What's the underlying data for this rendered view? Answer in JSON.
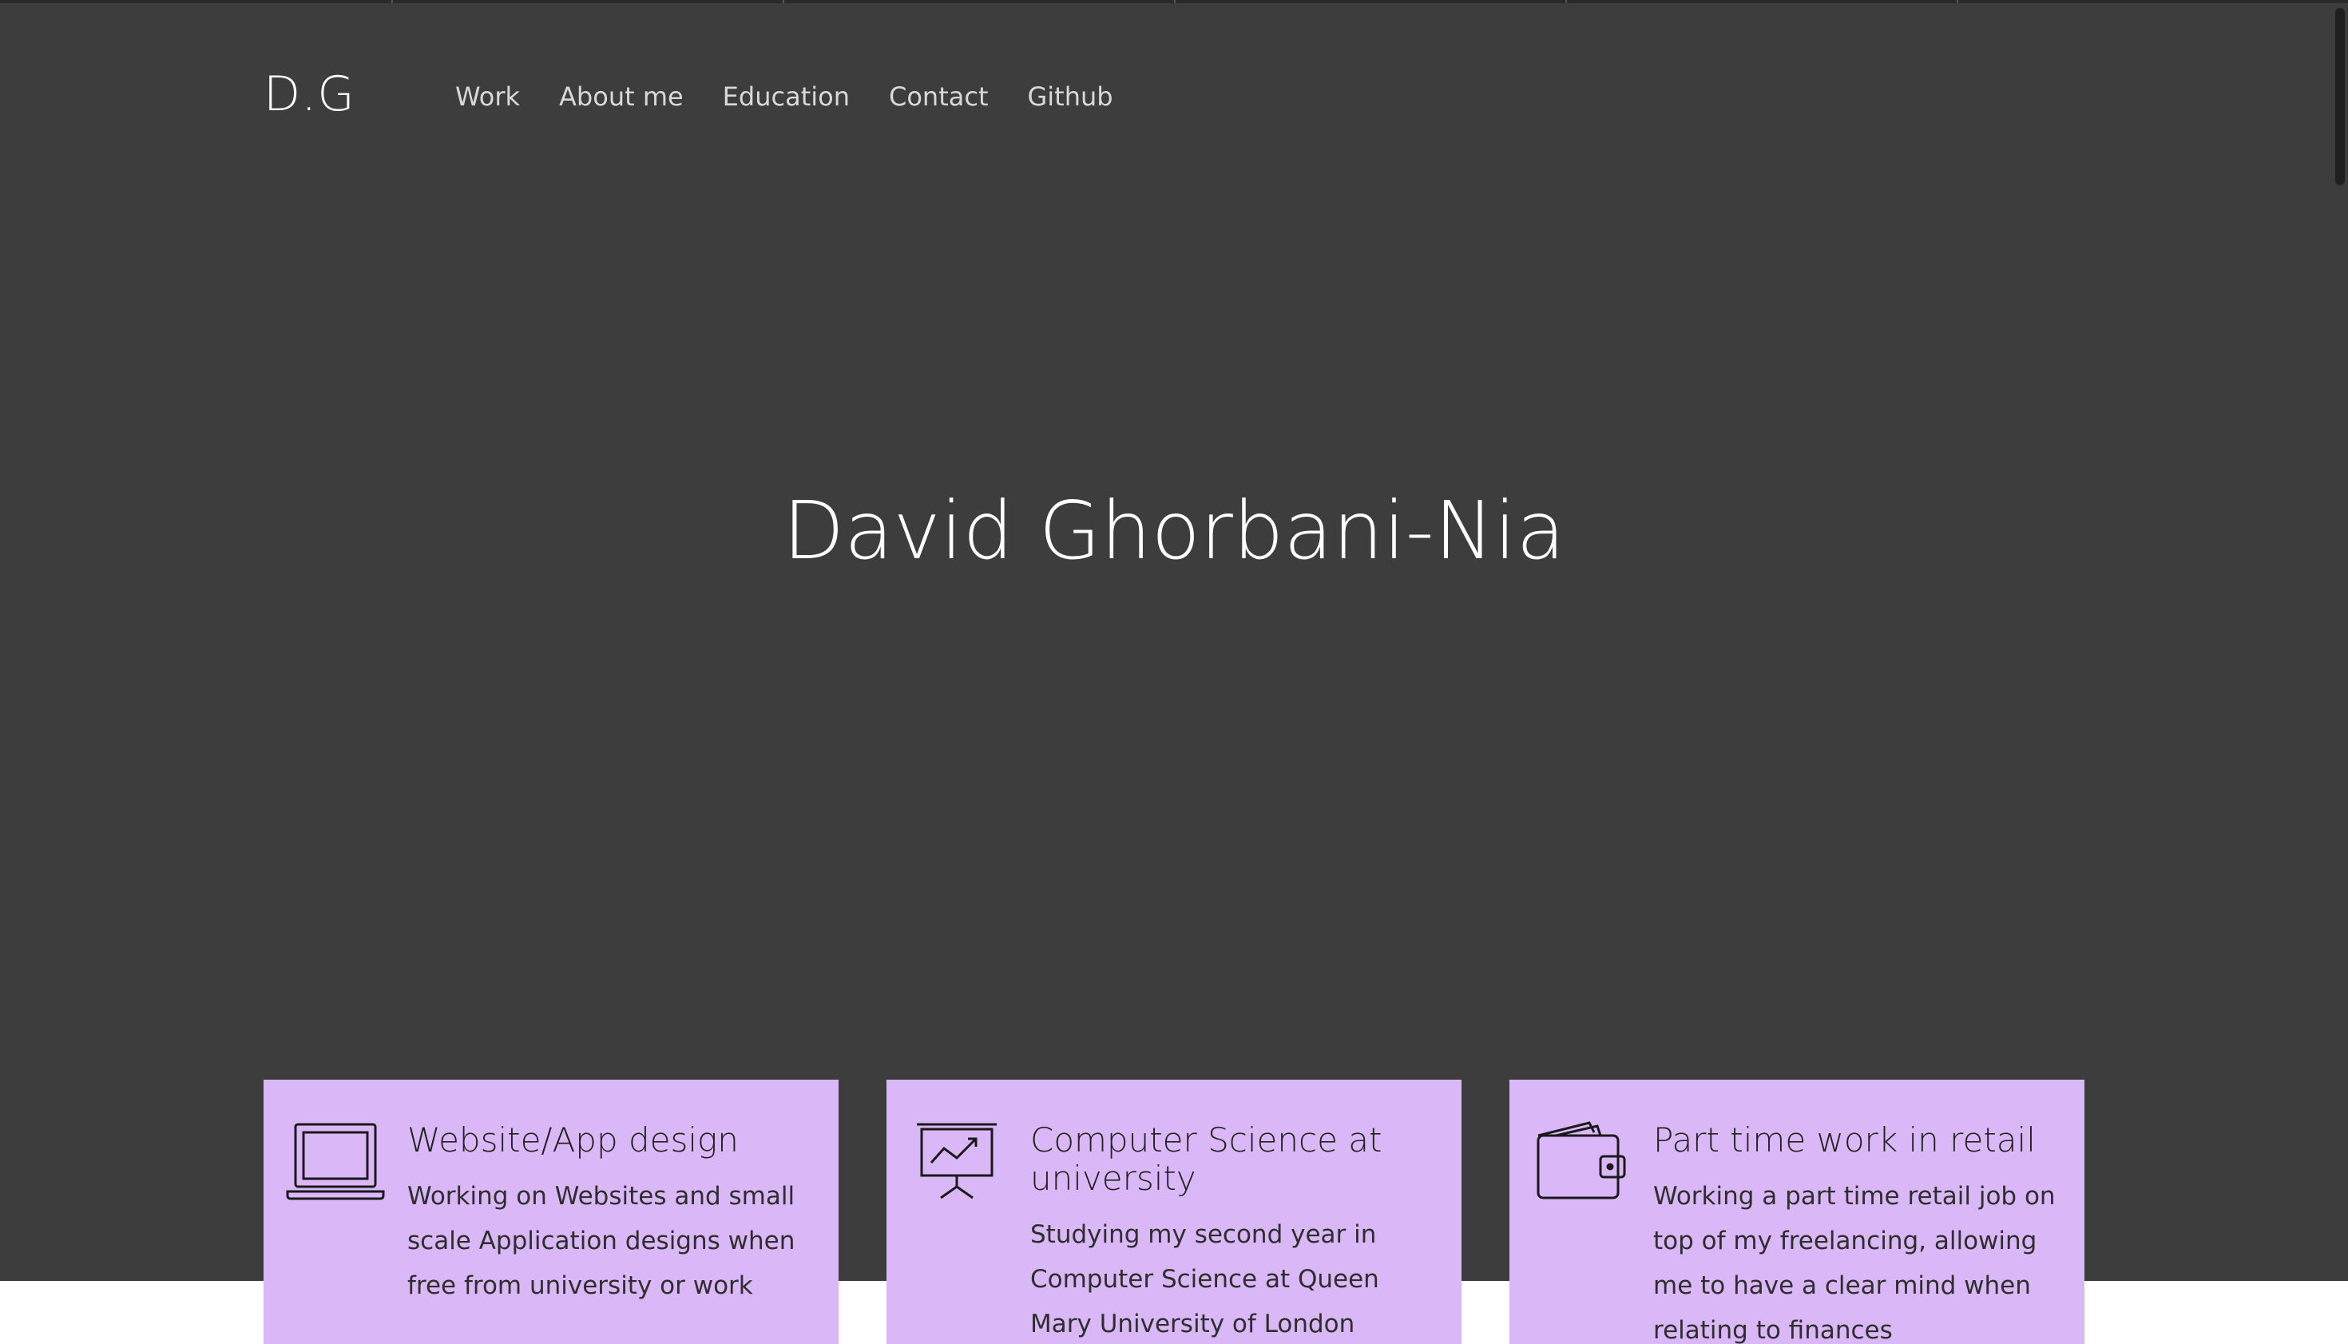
{
  "brand": {
    "logo_text": "D.G"
  },
  "nav": {
    "items": [
      {
        "label": "Work"
      },
      {
        "label": "About me"
      },
      {
        "label": "Education"
      },
      {
        "label": "Contact"
      },
      {
        "label": "Github"
      }
    ]
  },
  "hero": {
    "title": "David Ghorbani-Nia"
  },
  "cards": [
    {
      "icon": "laptop-icon",
      "title": "Website/App design",
      "text": "Working on Websites and small scale Application designs when free from university or work"
    },
    {
      "icon": "presentation-chart-icon",
      "title": "Computer Science at university",
      "text": "Studying my second year in Computer Science at Queen Mary University of London"
    },
    {
      "icon": "wallet-icon",
      "title": "Part time work in retail",
      "text": "Working a part time retail job on top of my freelancing, allowing me to have a clear mind when relating to finances"
    }
  ],
  "colors": {
    "hero_background": "#3d3d3d",
    "card_background": "#dab8f7",
    "page_background": "#ffffff",
    "nav_text": "#d9d9d9"
  }
}
